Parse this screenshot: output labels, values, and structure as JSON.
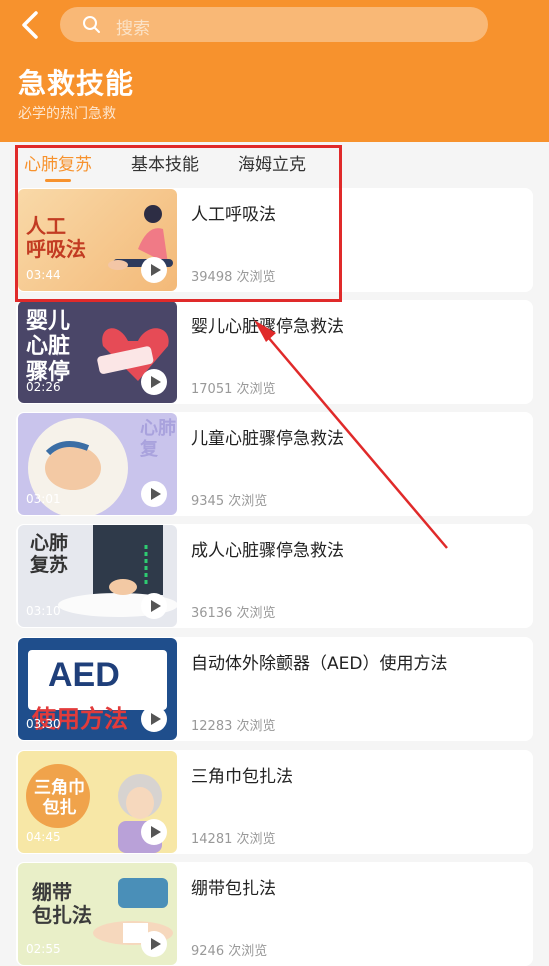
{
  "header": {
    "search_placeholder": "搜索",
    "title": "急救技能",
    "subtitle": "必学的热门急救"
  },
  "tabs": [
    {
      "label": "心肺复苏",
      "active": true
    },
    {
      "label": "基本技能",
      "active": false
    },
    {
      "label": "海姆立克",
      "active": false
    }
  ],
  "videos": [
    {
      "title": "人工呼吸法",
      "views": "39498 次浏览",
      "duration": "03:44",
      "thumb_text": "人工\n呼吸法"
    },
    {
      "title": "婴儿心脏骤停急救法",
      "views": "17051 次浏览",
      "duration": "02:26",
      "thumb_text": "婴儿\n心脏\n骤停"
    },
    {
      "title": "儿童心脏骤停急救法",
      "views": "9345 次浏览",
      "duration": "03:01",
      "thumb_text": "心肺\n复"
    },
    {
      "title": "成人心脏骤停急救法",
      "views": "36136 次浏览",
      "duration": "03:10",
      "thumb_text": "心肺\n复苏"
    },
    {
      "title": "自动体外除颤器（AED）使用方法",
      "views": "12283 次浏览",
      "duration": "03:30",
      "thumb_text": "AED",
      "thumb_text2": "使用方法"
    },
    {
      "title": "三角巾包扎法",
      "views": "14281 次浏览",
      "duration": "04:45",
      "thumb_text": "三角巾\n包扎"
    },
    {
      "title": "绷带包扎法",
      "views": "9246 次浏览",
      "duration": "02:55",
      "thumb_text": "绷带\n包扎法"
    }
  ],
  "colors": {
    "accent": "#f7922d",
    "annotation": "#e02a2a"
  }
}
